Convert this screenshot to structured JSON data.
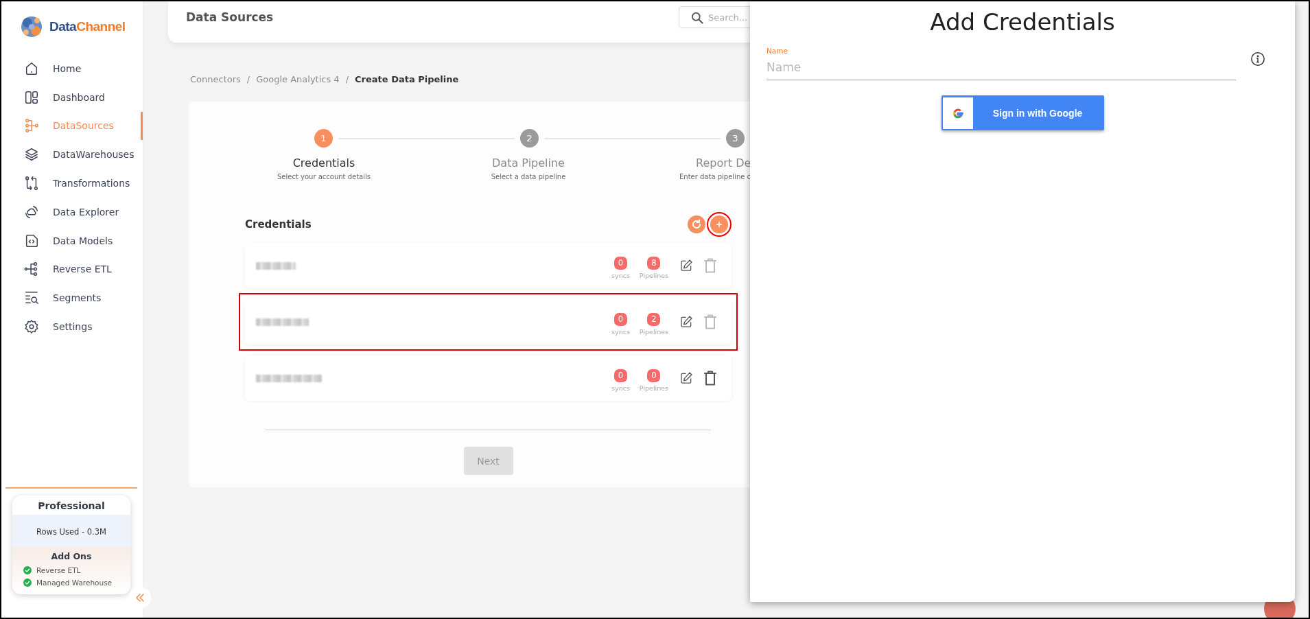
{
  "sidebar": {
    "logo": {
      "part_1": "Data",
      "part_2": "Channel"
    },
    "items": [
      {
        "label": "Home",
        "selected": false
      },
      {
        "label": "Dashboard",
        "selected": false
      },
      {
        "label": "DataSources",
        "selected": true
      },
      {
        "label": "DataWarehouses",
        "selected": false
      },
      {
        "label": "Transformations",
        "selected": false
      },
      {
        "label": "Data Explorer",
        "selected": false
      },
      {
        "label": "Data Models",
        "selected": false
      },
      {
        "label": "Reverse ETL",
        "selected": false
      },
      {
        "label": "Segments",
        "selected": false
      },
      {
        "label": "Settings",
        "selected": false
      }
    ],
    "plan": {
      "title": "Professional",
      "rows_used": "Rows Used - 0.3M",
      "addons_title": "Add Ons",
      "addons": [
        {
          "label": "Reverse ETL",
          "enabled": true
        },
        {
          "label": "Managed Warehouse",
          "enabled": true
        }
      ]
    }
  },
  "header": {
    "title": "Data Sources",
    "search": {
      "placeholder": "Search..."
    }
  },
  "breadcrumb": [
    {
      "label": "Connectors",
      "current": false
    },
    {
      "separator": "/",
      "label": "Google Analytics 4",
      "current": false
    },
    {
      "separator": "/",
      "label": "Create Data Pipeline",
      "current": true
    }
  ],
  "steps": [
    {
      "number": "1",
      "label": "Credentials",
      "description": "Select your account details",
      "active": true
    },
    {
      "number": "2",
      "label": "Data Pipeline",
      "description": "Select a data pipeline",
      "active": false
    },
    {
      "number": "3",
      "label": "Report De",
      "description": "Enter data pipeline c",
      "active": false
    }
  ],
  "credentials": {
    "title": "Credentials",
    "add_highlighted": true,
    "rows": [
      {
        "name_redacted": true,
        "syncs": "0",
        "syncs_label": "syncs",
        "pipelines": "8",
        "pipelines_label": "Pipelines",
        "delete_disabled": true,
        "highlighted": false
      },
      {
        "name_redacted": true,
        "syncs": "0",
        "syncs_label": "syncs",
        "pipelines": "2",
        "pipelines_label": "Pipelines",
        "delete_disabled": true,
        "highlighted": true
      },
      {
        "name_redacted": true,
        "syncs": "0",
        "syncs_label": "syncs",
        "pipelines": "0",
        "pipelines_label": "Pipelines",
        "delete_disabled": false,
        "highlighted": false
      }
    ],
    "next": {
      "label": "Next",
      "disabled": true
    }
  },
  "panel": {
    "title": "Add Credentials",
    "field": {
      "label": "Name",
      "placeholder": "Name"
    },
    "google_button": "Sign in with Google"
  }
}
